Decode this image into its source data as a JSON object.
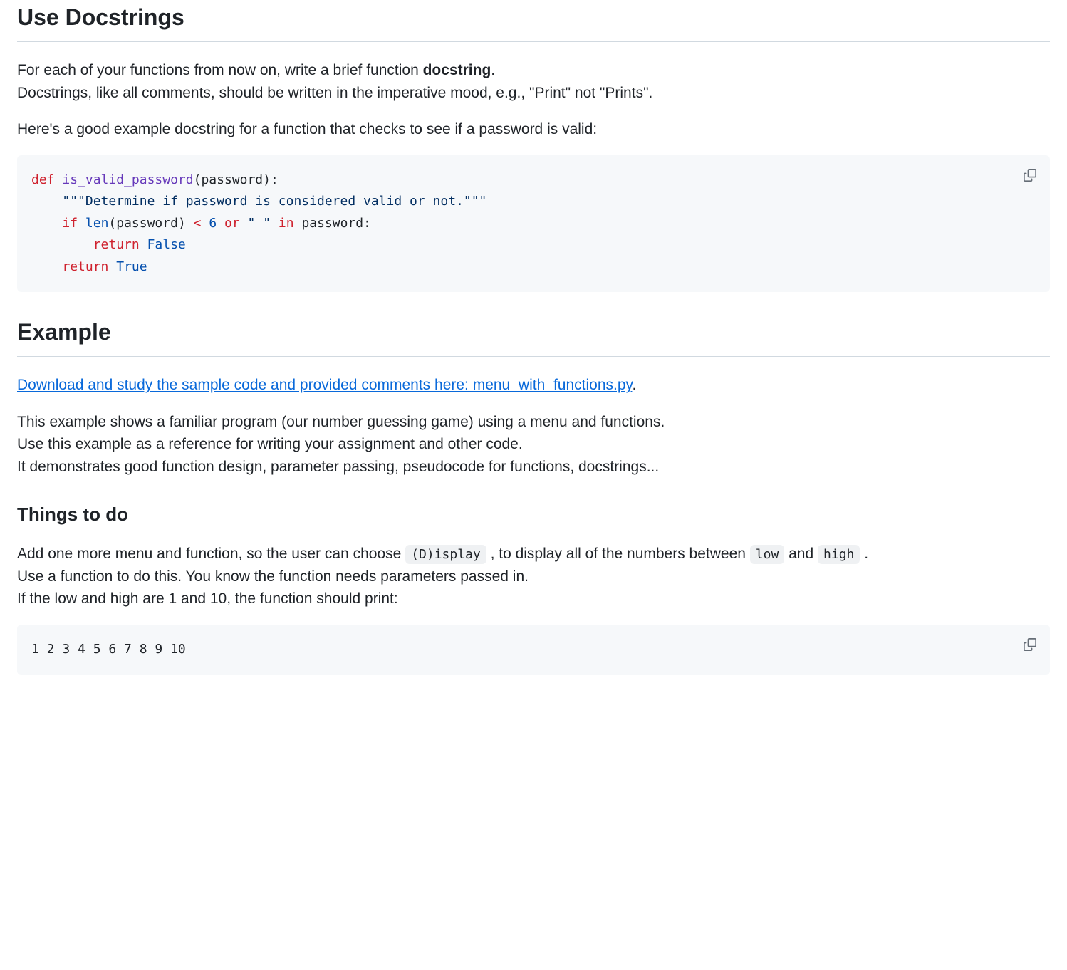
{
  "section1": {
    "heading": "Use Docstrings",
    "para1_a": "For each of your functions from now on, write a brief function ",
    "para1_b": "docstring",
    "para1_c": ".",
    "para2": "Docstrings, like all comments, should be written in the imperative mood, e.g., \"Print\" not \"Prints\".",
    "para3": "Here's a good example docstring for a function that checks to see if a password is valid:"
  },
  "code1": {
    "kw_def": "def",
    "fn": "is_valid_password",
    "sig_open": "(",
    "param": "password",
    "sig_close": "):",
    "docstring": "\"\"\"Determine if password is considered valid or not.\"\"\"",
    "kw_if": "if",
    "len": "len",
    "open1": "(",
    "var1": "password",
    "close1": ") ",
    "lt": "<",
    "num6": "6",
    "kw_or": "or",
    "space_str": "\" \"",
    "kw_in": "in",
    "var2": "password",
    "colon": ":",
    "kw_return1": "return",
    "false": "False",
    "kw_return2": "return",
    "true": "True"
  },
  "section2": {
    "heading": "Example",
    "link": "Download and study the sample code and provided comments here: menu_with_functions.py",
    "period": ".",
    "para1": "This example shows a familiar program (our number guessing game) using a menu and functions.",
    "para2": "Use this example as a reference for writing your assignment and other code.",
    "para3": "It demonstrates good function design, parameter passing, pseudocode for functions, docstrings..."
  },
  "section3": {
    "heading": "Things to do",
    "para1_a": "Add one more menu and function, so the user can choose ",
    "code_display": "(D)isplay",
    "para1_b": " , to display all of the numbers between ",
    "code_low": "low",
    "para1_c": " and ",
    "code_high": "high",
    "para1_d": " .",
    "para2": "Use a function to do this. You know the function needs parameters passed in.",
    "para3": "If the low and high are 1 and 10, the function should print:"
  },
  "code2": {
    "output": "1 2 3 4 5 6 7 8 9 10"
  }
}
